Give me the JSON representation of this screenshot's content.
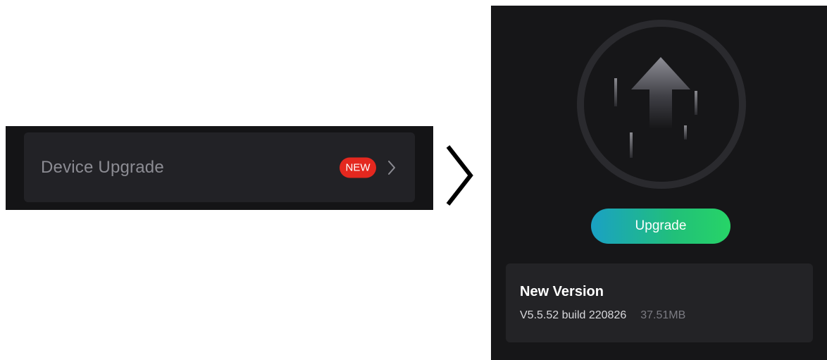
{
  "settings_row": {
    "label": "Device Upgrade",
    "badge": "NEW",
    "icon": "chevron-right-icon"
  },
  "transition": {
    "icon": "chevron-right-icon"
  },
  "upgrade_page": {
    "illustration_icon": "upload-arrow-icon",
    "button_label": "Upgrade",
    "version_card": {
      "title": "New Version",
      "build": "V5.5.52 build 220826",
      "size": "37.51MB"
    }
  },
  "colors": {
    "badge": "#e4281f",
    "button_gradient_start": "#1aa1c4",
    "button_gradient_end": "#27d467",
    "panel_background": "#161618",
    "card_background": "#232326"
  }
}
